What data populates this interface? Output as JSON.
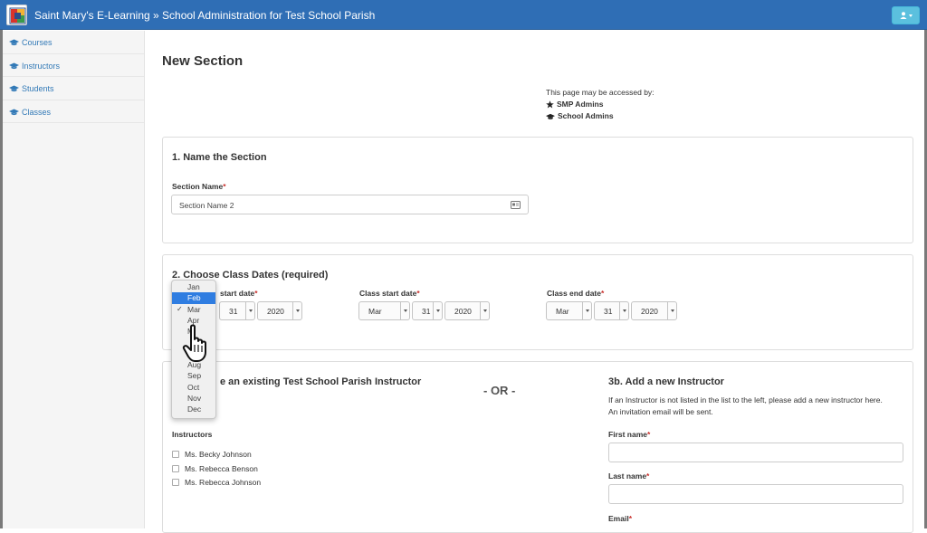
{
  "app": {
    "title": "Saint Mary's E-Learning » School Administration for Test School Parish"
  },
  "colors": {
    "navbar": "#2f6eb5",
    "accent": "#337ab7",
    "required": "#c9302c",
    "user_button": "#5bc0de",
    "highlight": "#2f7de1"
  },
  "sidebar": {
    "items": [
      {
        "label": "Courses",
        "icon": "graduation-cap-icon"
      },
      {
        "label": "Instructors",
        "icon": "graduation-cap-icon"
      },
      {
        "label": "Students",
        "icon": "graduation-cap-icon"
      },
      {
        "label": "Classes",
        "icon": "graduation-cap-icon"
      }
    ]
  },
  "page": {
    "title": "New Section",
    "access": {
      "intro": "This page may be accessed by:",
      "roles": [
        {
          "label": "SMP Admins",
          "icon": "star-icon"
        },
        {
          "label": "School Admins",
          "icon": "graduation-cap-icon"
        }
      ]
    }
  },
  "section1": {
    "title": "1. Name the Section",
    "name_label": "Section Name",
    "required_mark": "*",
    "name_value": "Section Name 2"
  },
  "section2": {
    "title": "2. Choose Class Dates (required)",
    "col1": {
      "label": "start date",
      "day": "31",
      "year": "2020"
    },
    "col2": {
      "label": "Class start date",
      "month": "Mar",
      "day": "31",
      "year": "2020"
    },
    "col3": {
      "label": "Class end date",
      "month": "Mar",
      "day": "31",
      "year": "2020"
    }
  },
  "section3": {
    "left_title": "e an existing Test School Parish Instructor",
    "or_text": "- OR -",
    "instructors_label": "Instructors",
    "instructors": [
      "Ms. Becky Johnson",
      "Ms. Rebecca Benson",
      "Ms. Rebecca Johnson"
    ],
    "right_title": "3b. Add a new Instructor",
    "hint_line1": "If an Instructor is not listed in the list to the left, please add a new instructor here.",
    "hint_line2": "An invitation email will be sent.",
    "first_name_label": "First name",
    "last_name_label": "Last name",
    "email_label": "Email"
  },
  "month_dropdown": {
    "options": [
      "Jan",
      "Feb",
      "Mar",
      "Apr",
      "M",
      "",
      "",
      "Aug",
      "Sep",
      "Oct",
      "Nov",
      "Dec"
    ],
    "highlighted": "Feb",
    "checked": "Mar",
    "check_mark": "✓"
  }
}
